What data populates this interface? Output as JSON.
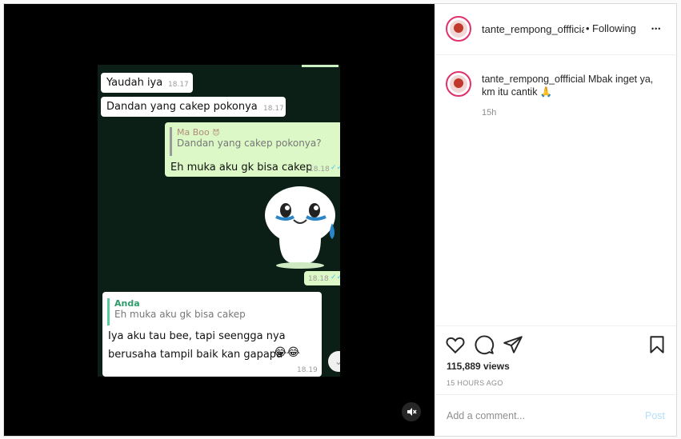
{
  "chat": {
    "messages": [
      {
        "text": "Yaudah iya",
        "time": "18.17"
      },
      {
        "text": "Dandan yang cakep pokonya",
        "time": "18.17"
      },
      {
        "quote_name": "Ma Boo",
        "quote_name_glyph": "😈",
        "quote_text": "Dandan yang cakep pokonya?",
        "text": "Eh muka aku gk bisa cakep",
        "time": "18.18"
      },
      {
        "sticker_time": "18.18"
      },
      {
        "quote_name": "Anda",
        "quote_text": "Eh muka aku gk bisa cakep",
        "text_line1": "Iya aku tau bee, tapi seengga nya",
        "text_line2": "berusaha tampil baik kan gapapa",
        "emoji": "😂😂",
        "time": "18.19"
      }
    ]
  },
  "post": {
    "username": "tante_rempong_offficial",
    "separator": "•",
    "follow_label": "Following",
    "more_label": "•••",
    "caption_username": "tante_rempong_offficial",
    "caption_text": "Mbak inget ya, km itu cantik 🙏",
    "caption_age": "15h",
    "views": "115,889 views",
    "time_ago": "15 HOURS AGO",
    "comment_placeholder": "Add a comment...",
    "post_label": "Post"
  },
  "icons": [
    "heart-icon",
    "comment-icon",
    "share-icon",
    "bookmark-icon",
    "mute-icon",
    "more-icon"
  ],
  "colors": {
    "accent": "#0095f6",
    "post_disabled": "#b2dffc",
    "chat_bg": "#0b1f17",
    "bubble_out": "#dcf8c6"
  }
}
